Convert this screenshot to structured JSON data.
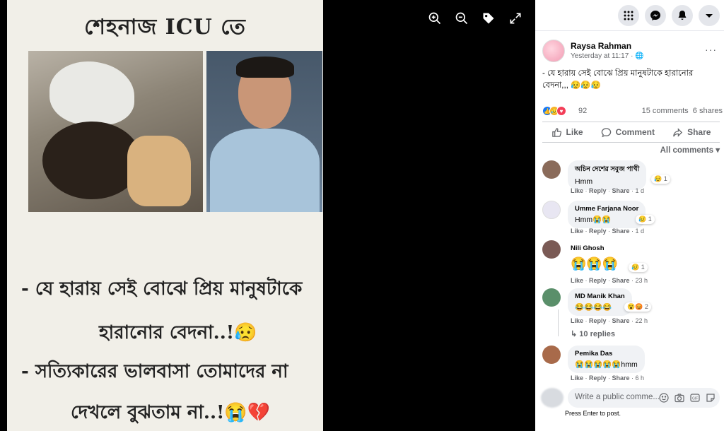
{
  "photo": {
    "overlay_title": "শেহনাজ ICU তে",
    "caption_lines": [
      "- যে হারায় সেই বোঝে প্রিয় মানুষটাকে",
      "হারানোর বেদনা..!😥",
      "- সত্যিকারের ভালবাসা তোমাদের না",
      "দেখলে বুঝতাম না..!😭💔"
    ]
  },
  "viewer_tools": [
    "zoom-in-icon",
    "zoom-out-icon",
    "tag-icon",
    "expand-icon"
  ],
  "topbar_icons": [
    "menu-grid-icon",
    "messenger-icon",
    "notifications-icon",
    "account-dropdown-icon"
  ],
  "post": {
    "author": "Raysa Rahman",
    "time": "Yesterday at 11:17 · 🌐",
    "more": "···",
    "text": "- যে হারায় সেই বোঝে প্রিয় মানুষটাকে হারানোর বেদনা,,, 😥😥😥",
    "reaction_count": "92",
    "comments_count": "15 comments",
    "shares_count": "6 shares",
    "actions": {
      "like": "Like",
      "comment": "Comment",
      "share": "Share"
    },
    "filter": "All comments ▾"
  },
  "comments": [
    {
      "name": "অচিন দেশের সবুজ পাখী",
      "text": "Hmm",
      "react": "😥 1",
      "like": "Like",
      "reply": "Reply",
      "share": "Share",
      "time": "1 d",
      "avatar_color": "#8a6b5a"
    },
    {
      "name": "Umme Farjana Noor",
      "text": "Hmm😭😭",
      "react": "😥 1",
      "like": "Like",
      "reply": "Reply",
      "share": "Share",
      "time": "1 d",
      "avatar_color": "#e8e6f2"
    },
    {
      "name": "Nili Ghosh",
      "text": "😭😭😭",
      "react": "😥 1",
      "like": "Like",
      "reply": "Reply",
      "share": "Share",
      "time": "23 h",
      "avatar_color": "#7a5a55"
    },
    {
      "name": "MD Manik Khan",
      "text": "😂😂😂😂",
      "react": "😮😡 2",
      "like": "Like",
      "reply": "Reply",
      "share": "Share",
      "time": "22 h",
      "replies": "10 replies",
      "avatar_color": "#5a8f6a"
    },
    {
      "name": "Pemika Das",
      "text": "😭😭😭😭😭hmm",
      "react": "",
      "like": "Like",
      "reply": "Reply",
      "share": "Share",
      "time": "6 h",
      "avatar_color": "#a86a4a"
    }
  ],
  "composer": {
    "placeholder": "Write a public comme...",
    "hint": "Press Enter to post."
  }
}
